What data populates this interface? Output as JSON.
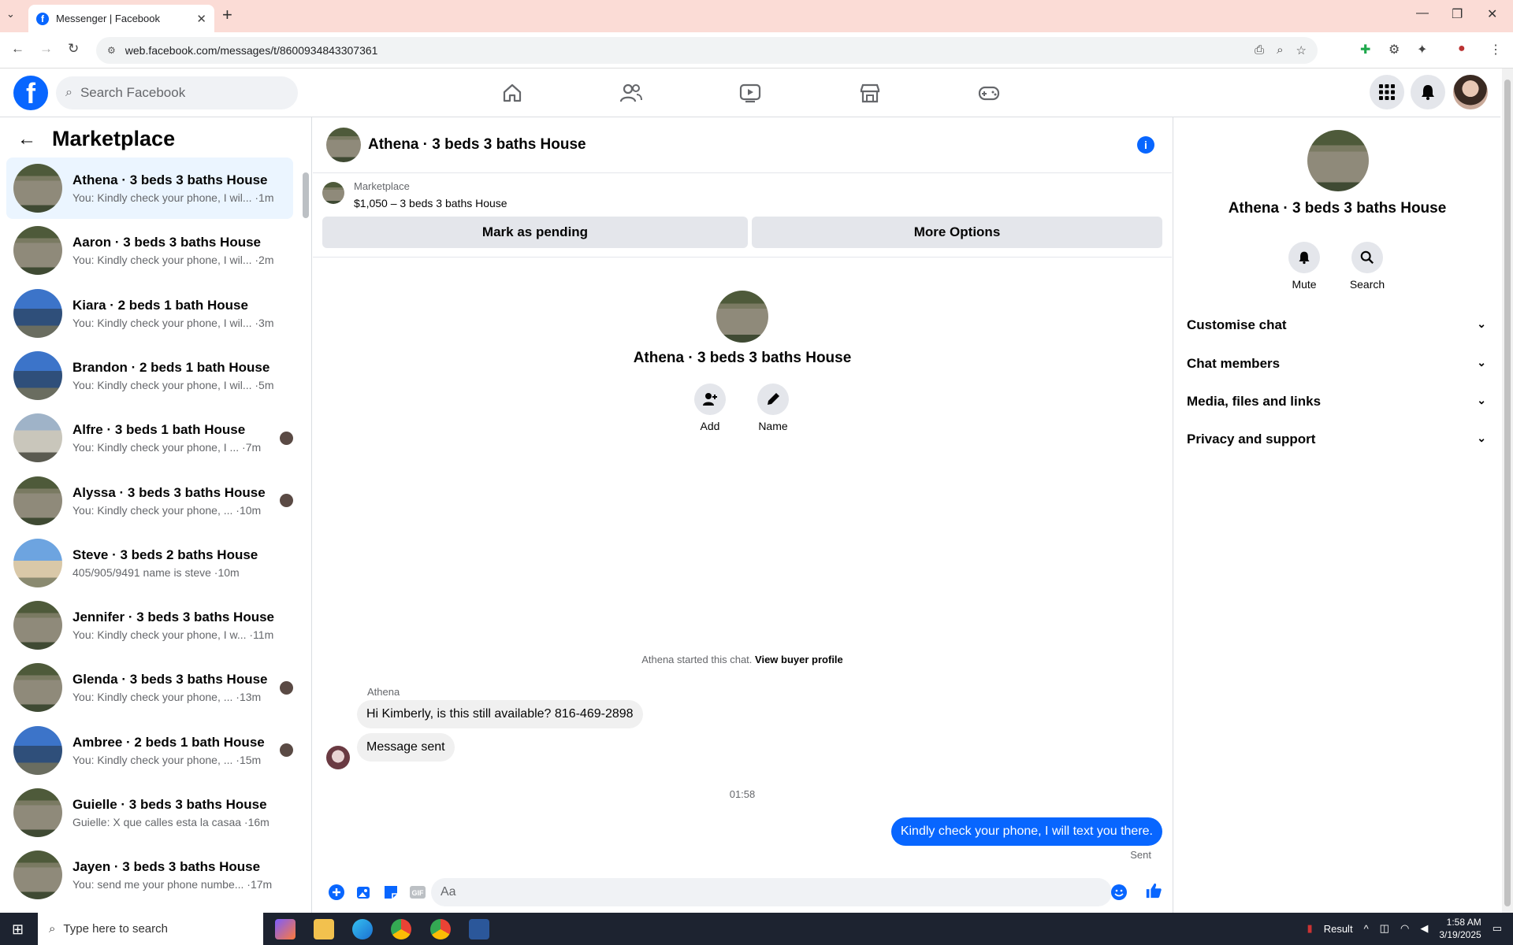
{
  "browser": {
    "tab_title": "Messenger | Facebook",
    "url": "web.facebook.com/messages/t/8600934843307361"
  },
  "fb": {
    "search_placeholder": "Search Facebook"
  },
  "sidebar": {
    "title": "Marketplace",
    "conversations": [
      {
        "name": "Athena · 3 beds 3 baths House",
        "preview": "You: Kindly check your phone, I wil... ·1m",
        "thumb": "g",
        "active": true,
        "seen": false
      },
      {
        "name": "Aaron · 3 beds 3 baths House",
        "preview": "You: Kindly check your phone, I wil... ·2m",
        "thumb": "g",
        "active": false,
        "seen": false
      },
      {
        "name": "Kiara · 2 beds 1 bath House",
        "preview": "You: Kindly check your phone, I wil... ·3m",
        "thumb": "b",
        "active": false,
        "seen": false
      },
      {
        "name": "Brandon · 2 beds 1 bath House",
        "preview": "You: Kindly check your phone, I wil... ·5m",
        "thumb": "b",
        "active": false,
        "seen": false
      },
      {
        "name": "Alfre · 3 beds 1 bath House",
        "preview": "You: Kindly check your phone, I ... ·7m",
        "thumb": "w",
        "active": false,
        "seen": true
      },
      {
        "name": "Alyssa · 3 beds 3 baths House",
        "preview": "You: Kindly check your phone, ... ·10m",
        "thumb": "g",
        "active": false,
        "seen": true
      },
      {
        "name": "Steve · 3 beds 2 baths House",
        "preview": "405/905/9491 name is steve ·10m",
        "thumb": "s",
        "active": false,
        "seen": false
      },
      {
        "name": "Jennifer · 3 beds 3 baths House",
        "preview": "You: Kindly check your phone, I w... ·11m",
        "thumb": "g",
        "active": false,
        "seen": false
      },
      {
        "name": "Glenda · 3 beds 3 baths House",
        "preview": "You: Kindly check your phone, ... ·13m",
        "thumb": "g",
        "active": false,
        "seen": true
      },
      {
        "name": "Ambree · 2 beds 1 bath House",
        "preview": "You: Kindly check your phone, ... ·15m",
        "thumb": "b",
        "active": false,
        "seen": true
      },
      {
        "name": "Guielle · 3 beds 3 baths House",
        "preview": "Guielle: X que calles esta la casaa ·16m",
        "thumb": "g",
        "active": false,
        "seen": false
      },
      {
        "name": "Jayen · 3 beds 3 baths House",
        "preview": "You: send me your phone numbe... ·17m",
        "thumb": "g",
        "active": false,
        "seen": false
      }
    ]
  },
  "chat": {
    "title": "Athena · 3 beds 3 baths House",
    "marketplace_label": "Marketplace",
    "listing": "$1,050 – 3 beds 3 baths House",
    "mark_pending": "Mark as pending",
    "more_options": "More Options",
    "profile_name": "Athena · 3 beds 3 baths House",
    "add_label": "Add",
    "name_label": "Name",
    "started_text": "Athena started this chat.",
    "view_buyer": "View buyer profile",
    "sender": "Athena",
    "msg1": "Hi Kimberly, is this still available? 816-469-2898",
    "msg2": "Message sent",
    "timestamp": "01:58",
    "my_msg": "Kindly check your phone, I will text you there.",
    "sent_label": "Sent",
    "composer_placeholder": "Aa"
  },
  "right_panel": {
    "name": "Athena · 3 beds 3 baths House",
    "mute": "Mute",
    "search": "Search",
    "sections": [
      "Customise chat",
      "Chat members",
      "Media, files and links",
      "Privacy and support"
    ]
  },
  "taskbar": {
    "search_placeholder": "Type here to search",
    "result": "Result",
    "time": "1:58 AM",
    "date": "3/19/2025"
  }
}
